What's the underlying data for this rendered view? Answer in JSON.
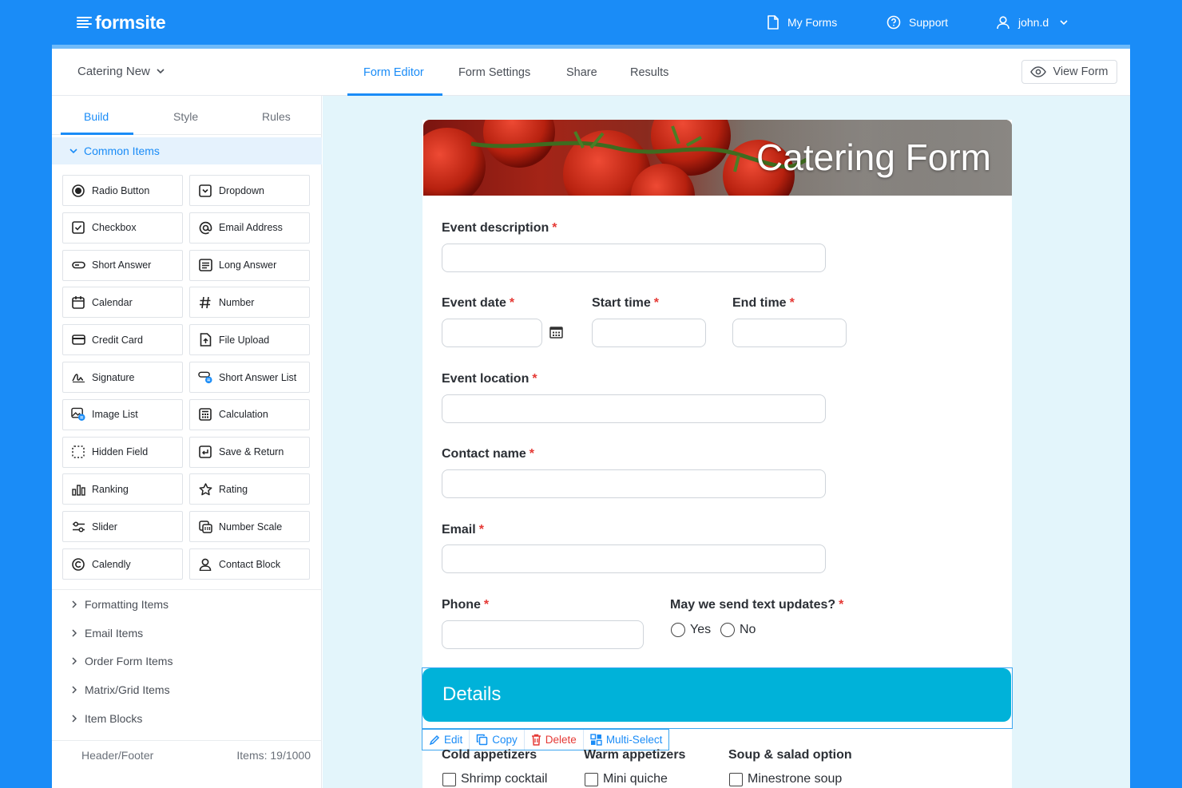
{
  "brand": {
    "name": "formsite",
    "color": "#1a8cf7"
  },
  "topnav": {
    "my_forms": "My Forms",
    "support": "Support",
    "user": "john.d"
  },
  "form_selector": {
    "label": "Catering New"
  },
  "main_tabs": [
    {
      "label": "Form Editor",
      "active": true
    },
    {
      "label": "Form Settings"
    },
    {
      "label": "Share"
    },
    {
      "label": "Results"
    }
  ],
  "view_form": "View Form",
  "side_tabs": [
    {
      "label": "Build",
      "active": true
    },
    {
      "label": "Style"
    },
    {
      "label": "Rules"
    }
  ],
  "common_items_header": "Common Items",
  "items": [
    {
      "label": "Radio Button",
      "icon": "radio-button-icon"
    },
    {
      "label": "Dropdown",
      "icon": "dropdown-icon"
    },
    {
      "label": "Checkbox",
      "icon": "checkbox-icon"
    },
    {
      "label": "Email Address",
      "icon": "at-sign-icon"
    },
    {
      "label": "Short Answer",
      "icon": "short-answer-icon"
    },
    {
      "label": "Long Answer",
      "icon": "long-answer-icon"
    },
    {
      "label": "Calendar",
      "icon": "calendar-icon"
    },
    {
      "label": "Number",
      "icon": "hash-icon"
    },
    {
      "label": "Credit Card",
      "icon": "credit-card-icon"
    },
    {
      "label": "File Upload",
      "icon": "file-upload-icon"
    },
    {
      "label": "Signature",
      "icon": "signature-icon"
    },
    {
      "label": "Short Answer List",
      "icon": "short-answer-list-icon"
    },
    {
      "label": "Image List",
      "icon": "image-list-icon"
    },
    {
      "label": "Calculation",
      "icon": "calculator-icon"
    },
    {
      "label": "Hidden Field",
      "icon": "hidden-field-icon"
    },
    {
      "label": "Save & Return",
      "icon": "save-return-icon"
    },
    {
      "label": "Ranking",
      "icon": "ranking-icon"
    },
    {
      "label": "Rating",
      "icon": "star-icon"
    },
    {
      "label": "Slider",
      "icon": "slider-icon"
    },
    {
      "label": "Number Scale",
      "icon": "number-scale-icon"
    },
    {
      "label": "Calendly",
      "icon": "calendly-icon"
    },
    {
      "label": "Contact Block",
      "icon": "contact-block-icon"
    }
  ],
  "collapsed_sections": [
    "Formatting Items",
    "Email Items",
    "Order Form Items",
    "Matrix/Grid Items",
    "Item Blocks"
  ],
  "panel_footer": {
    "header_footer": "Header/Footer",
    "items_count": "Items: 19/1000"
  },
  "form": {
    "banner_title": "Catering Form",
    "fields": {
      "event_description": "Event description",
      "event_date": "Event date",
      "start_time": "Start time",
      "end_time": "End time",
      "event_location": "Event location",
      "contact_name": "Contact name",
      "email": "Email",
      "phone": "Phone",
      "text_updates": "May we send text updates?"
    },
    "required_mark": "*",
    "text_updates_options": [
      "Yes",
      "No"
    ],
    "details_heading": "Details",
    "toolbar": {
      "edit": "Edit",
      "copy": "Copy",
      "delete": "Delete",
      "multi_select": "Multi-Select"
    },
    "menu": {
      "cold": {
        "title": "Cold appetizers",
        "first": "Shrimp cocktail"
      },
      "warm": {
        "title": "Warm appetizers",
        "first": "Mini quiche"
      },
      "soup": {
        "title": "Soup & salad option",
        "first": "Minestrone soup"
      }
    }
  }
}
